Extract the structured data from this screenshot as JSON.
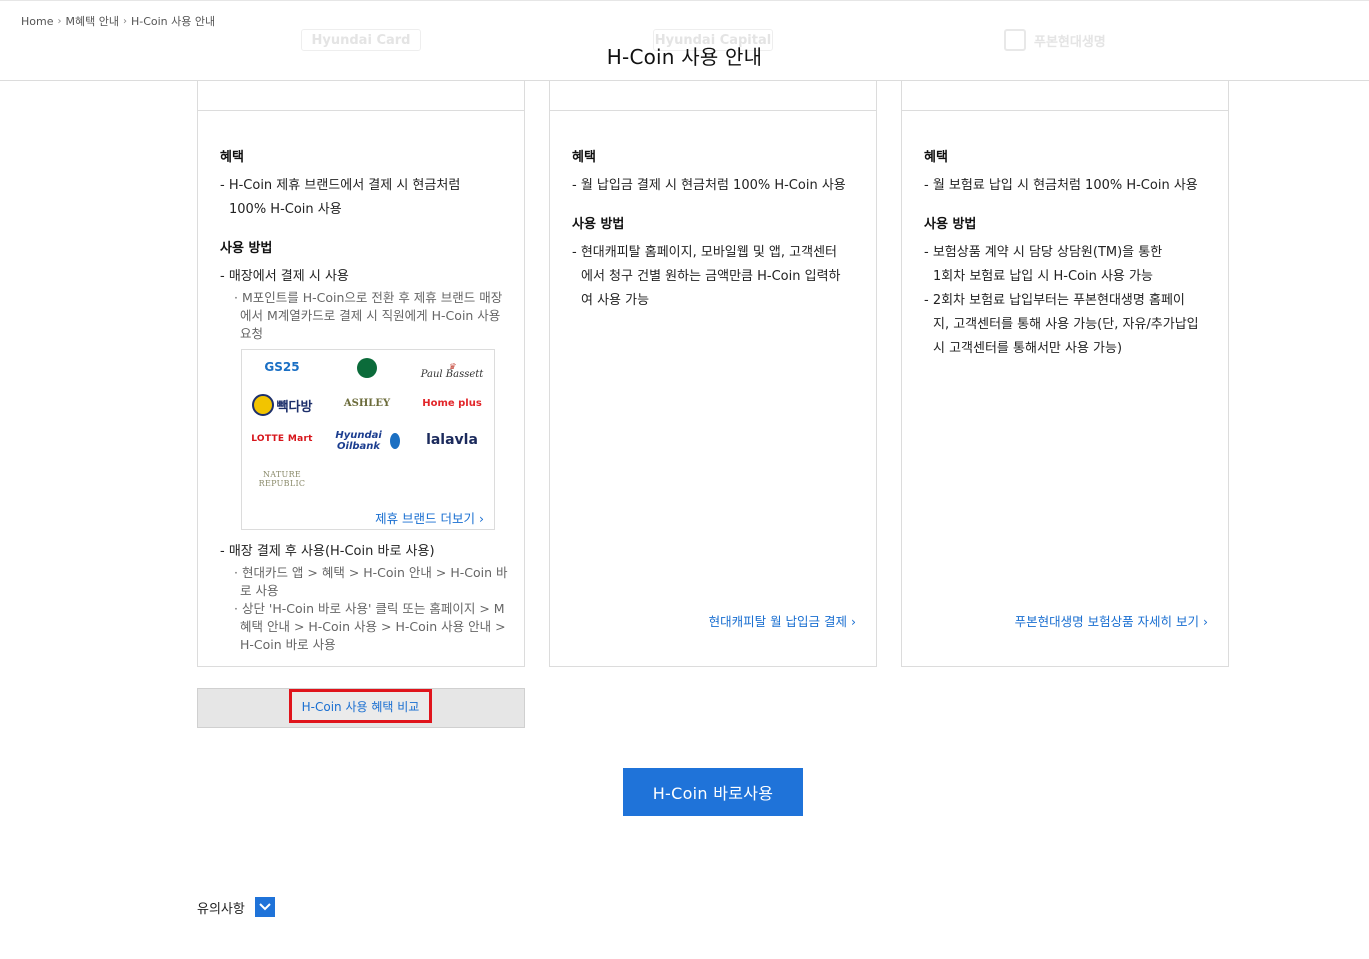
{
  "header": {
    "breadcrumb": [
      "Home",
      "M혜택 안내",
      "H-Coin 사용 안내"
    ],
    "title": "H-Coin 사용 안내",
    "ghost_logos": [
      "Hyundai Card",
      "Hyundai Capital",
      "푸본현대생명"
    ]
  },
  "cards": [
    {
      "benefit_title": "혜택",
      "benefit_lines": [
        "- H-Coin 제휴 브랜드에서 결제 시 현금처럼",
        "100% H-Coin 사용"
      ],
      "usage_title": "사용 방법",
      "method1": "- 매장에서 결제 시 사용",
      "method1_sub": "· M포인트를 H-Coin으로 전환 후 제휴 브랜드 매장에서 M계열카드로 결제 시 직원에게 H-Coin 사용 요청",
      "brands": [
        "GS25",
        "Starbucks",
        "Paul Bassett",
        "빽다방",
        "ASHLEY",
        "Home plus",
        "LOTTE Mart",
        "Hyundai Oilbank",
        "lalavla",
        "NATURE REPUBLIC"
      ],
      "brands_more": "제휴 브랜드 더보기",
      "method2": "- 매장 결제 후 사용(H-Coin 바로 사용)",
      "method2_sub": [
        "· 현대카드 앱 > 혜택 > H-Coin 안내 > H-Coin 바로 사용",
        "· 상단 'H-Coin 바로 사용' 클릭 또는 홈페이지 > M혜택 안내 > H-Coin 사용 > H-Coin 사용 안내 > H-Coin 바로 사용"
      ]
    },
    {
      "benefit_title": "혜택",
      "benefit": "- 월 납입금 결제 시 현금처럼 100% H-Coin 사용",
      "usage_title": "사용 방법",
      "usage_lines": [
        "- 현대캐피탈 홈페이지, 모바일웹 및 앱, 고객센터",
        "에서 청구 건별 원하는 금액만큼 H-Coin 입력하",
        "여 사용 가능"
      ],
      "link": "현대캐피탈 월 납입금 결제"
    },
    {
      "benefit_title": "혜택",
      "benefit": "- 월 보험료 납입 시 현금처럼 100% H-Coin 사용",
      "usage_title": "사용 방법",
      "usage_lines_a": [
        "- 보험상품 계약 시 담당 상담원(TM)을 통한",
        "1회차 보험료 납입 시 H-Coin 사용 가능"
      ],
      "usage_lines_b": [
        "- 2회차 보험료 납입부터는 푸본현대생명 홈페이",
        "지, 고객센터를 통해 사용 가능(단, 자유/추가납입",
        "시 고객센터를 통해서만 사용 가능)"
      ],
      "link": "푸본현대생명 보험상품 자세히 보기"
    }
  ],
  "compare_button": "H-Coin 사용 혜택 비교",
  "cta_button": "H-Coin 바로사용",
  "notice_label": "유의사항",
  "colors": {
    "accent": "#1f73d9",
    "highlight": "#e0141c",
    "link": "#1a6fd1"
  }
}
